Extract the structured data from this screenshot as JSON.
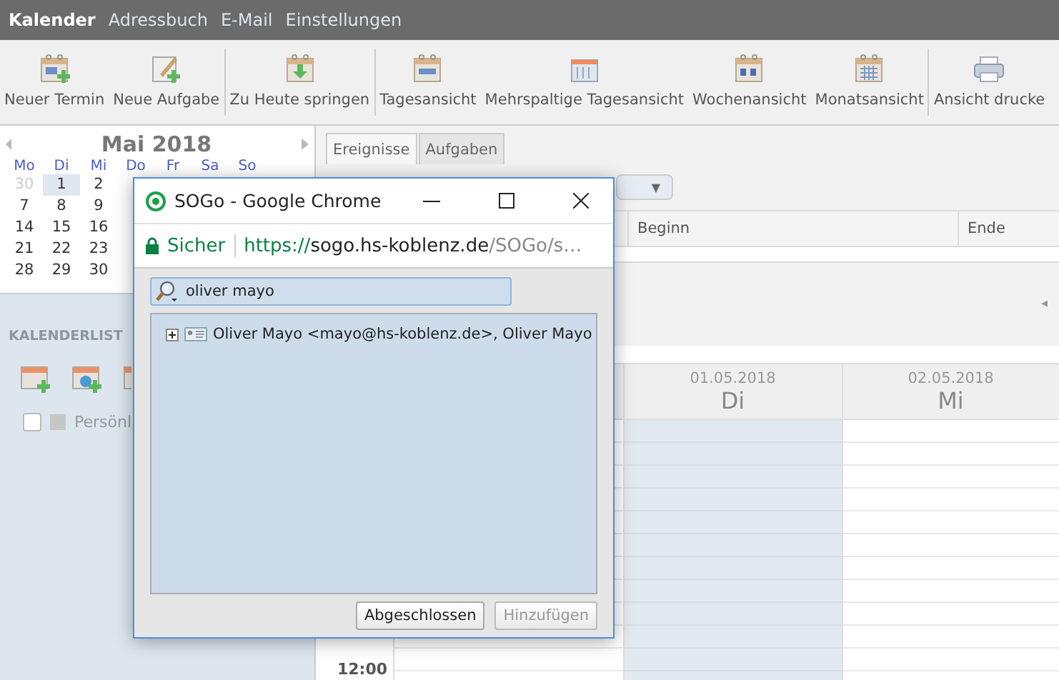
{
  "menu": [
    {
      "label": "Kalender",
      "selected": true
    },
    {
      "label": "Adressbuch",
      "selected": false
    },
    {
      "label": "E-Mail",
      "selected": false
    },
    {
      "label": "Einstellungen",
      "selected": false
    }
  ],
  "toolbar": [
    [
      {
        "kind": "new-event",
        "label": "Neuer Termin"
      },
      {
        "kind": "new-task",
        "label": "Neue Aufgabe"
      }
    ],
    [
      {
        "kind": "today",
        "label": "Zu Heute springen"
      }
    ],
    [
      {
        "kind": "day",
        "label": "Tagesansicht"
      },
      {
        "kind": "multi",
        "label": "Mehrspaltige Tagesansicht"
      },
      {
        "kind": "week",
        "label": "Wochenansicht"
      },
      {
        "kind": "month",
        "label": "Monatsansicht"
      }
    ],
    [
      {
        "kind": "print",
        "label": "Ansicht drucke"
      }
    ]
  ],
  "mini_calendar": {
    "title": "Mai 2018",
    "weekdays": [
      "Mo",
      "Di",
      "Mi",
      "Do",
      "Fr",
      "Sa",
      "So"
    ],
    "weeks": [
      [
        {
          "day": "30",
          "other_month": true,
          "selected": false
        },
        {
          "day": "1",
          "other_month": false,
          "selected": true
        },
        {
          "day": "2",
          "other_month": false,
          "selected": false
        }
      ],
      [
        {
          "day": "7",
          "other_month": false,
          "selected": false
        },
        {
          "day": "8",
          "other_month": false,
          "selected": false
        },
        {
          "day": "9",
          "other_month": false,
          "selected": false
        }
      ],
      [
        {
          "day": "14",
          "other_month": false,
          "selected": false
        },
        {
          "day": "15",
          "other_month": false,
          "selected": false
        },
        {
          "day": "16",
          "other_month": false,
          "selected": false
        }
      ],
      [
        {
          "day": "21",
          "other_month": false,
          "selected": false
        },
        {
          "day": "22",
          "other_month": false,
          "selected": false
        },
        {
          "day": "23",
          "other_month": false,
          "selected": false
        }
      ],
      [
        {
          "day": "28",
          "other_month": false,
          "selected": false
        },
        {
          "day": "29",
          "other_month": false,
          "selected": false
        },
        {
          "day": "30",
          "other_month": false,
          "selected": false
        }
      ]
    ]
  },
  "calendar_list": {
    "title": "KALENDERLIST",
    "items": [
      {
        "label": "Persönl",
        "checked": false
      }
    ]
  },
  "tabs": [
    {
      "label": "Ereignisse",
      "selected": true
    },
    {
      "label": "Aufgaben",
      "selected": false
    }
  ],
  "filter_dropdown": {
    "arrow": "▼"
  },
  "table": {
    "columns": [
      "Beginn",
      "Ende"
    ]
  },
  "nav_arrow": "◂",
  "day_columns": [
    {
      "date": "01.05.2018",
      "weekday": "Di",
      "today": true
    },
    {
      "date": "02.05.2018",
      "weekday": "Mi",
      "today": false
    }
  ],
  "time_label": "12:00",
  "popup": {
    "title": "SOGo - Google Chrome",
    "secure_label": "Sicher",
    "url_scheme": "https://",
    "url_host": "sogo.hs-koblenz.de",
    "url_path": "/SOGo/s…",
    "search": {
      "value": "oliver mayo"
    },
    "results": [
      {
        "label": "Oliver Mayo <mayo@hs-koblenz.de>, Oliver Mayo",
        "expanded": false
      }
    ],
    "buttons": [
      {
        "label": "Abgeschlossen",
        "disabled": false
      },
      {
        "label": "Hinzufügen",
        "disabled": true
      }
    ]
  }
}
